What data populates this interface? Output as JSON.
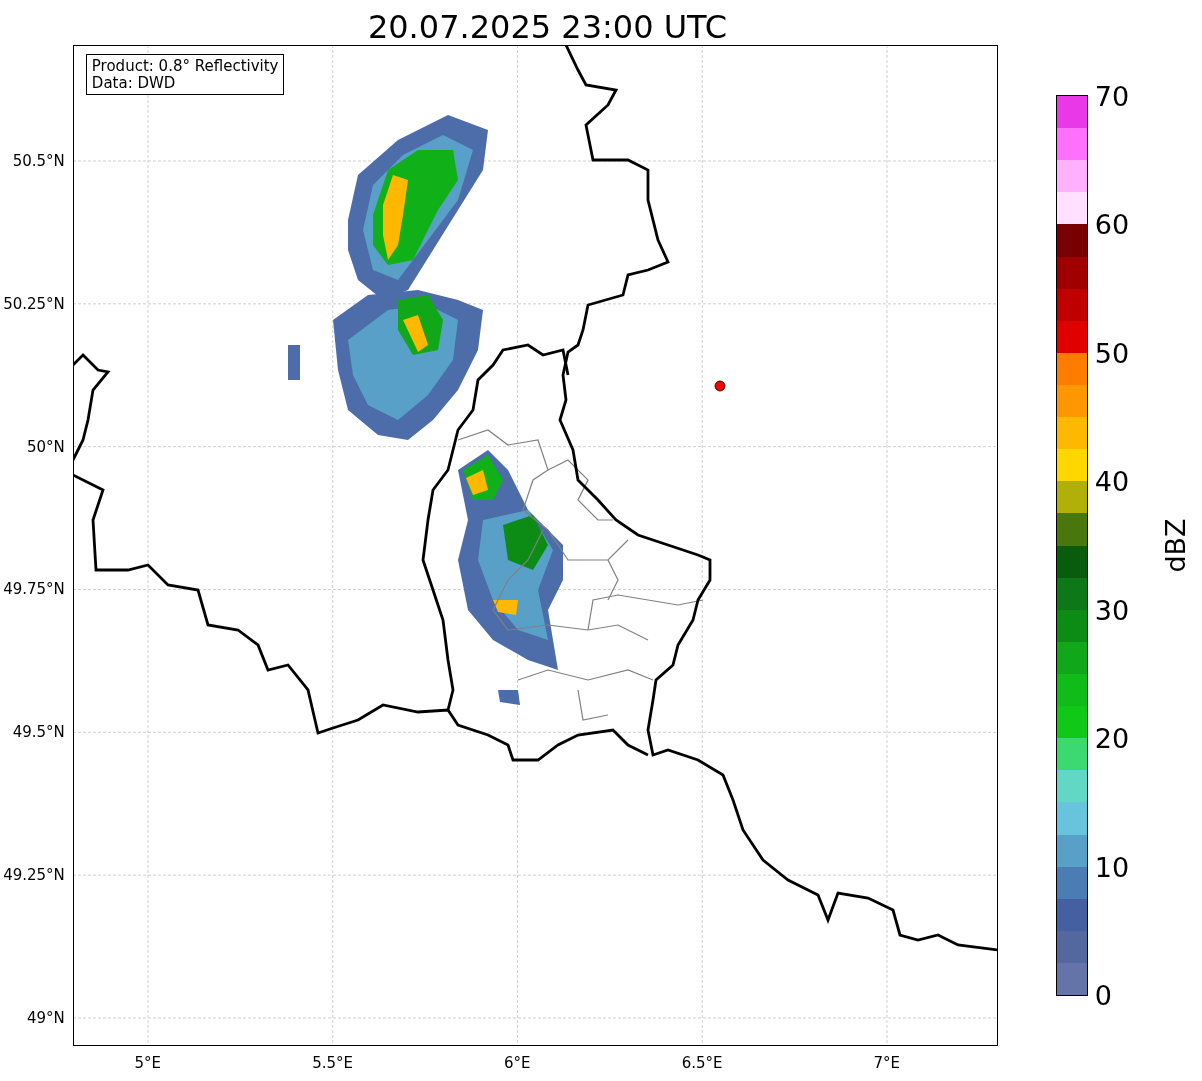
{
  "title": "20.07.2025 23:00 UTC",
  "map": {
    "annotation": [
      "Product: 0.8° Reflectivity",
      "Data: DWD"
    ],
    "y_tick_labels": [
      "50.5°N",
      "50.25°N",
      "50°N",
      "49.75°N",
      "49.5°N",
      "49.25°N",
      "49°N"
    ],
    "x_tick_labels": [
      "5°E",
      "5.5°E",
      "6°E",
      "6.5°E",
      "7°E"
    ]
  },
  "colorbar": {
    "label": "dBZ",
    "ticks": [
      "70",
      "60",
      "50",
      "40",
      "30",
      "20",
      "10",
      "0"
    ],
    "bins": [
      {
        "color": "#e838e8"
      },
      {
        "color": "#ff70ff"
      },
      {
        "color": "#ffb0ff"
      },
      {
        "color": "#ffe0ff"
      },
      {
        "color": "#780000"
      },
      {
        "color": "#a00000"
      },
      {
        "color": "#c00000"
      },
      {
        "color": "#e00000"
      },
      {
        "color": "#ff7c00"
      },
      {
        "color": "#ff9800"
      },
      {
        "color": "#ffb800"
      },
      {
        "color": "#ffd700"
      },
      {
        "color": "#b0b008"
      },
      {
        "color": "#48780c"
      },
      {
        "color": "#085c0c"
      },
      {
        "color": "#0c7818"
      },
      {
        "color": "#0c8c14"
      },
      {
        "color": "#10a818"
      },
      {
        "color": "#10bc18"
      },
      {
        "color": "#10c818"
      },
      {
        "color": "#3cd870"
      },
      {
        "color": "#60d8c4"
      },
      {
        "color": "#68c4dc"
      },
      {
        "color": "#58a0c8"
      },
      {
        "color": "#4c7cb4"
      },
      {
        "color": "#4460a0"
      },
      {
        "color": "#5468a0"
      },
      {
        "color": "#6474a8"
      }
    ]
  }
}
